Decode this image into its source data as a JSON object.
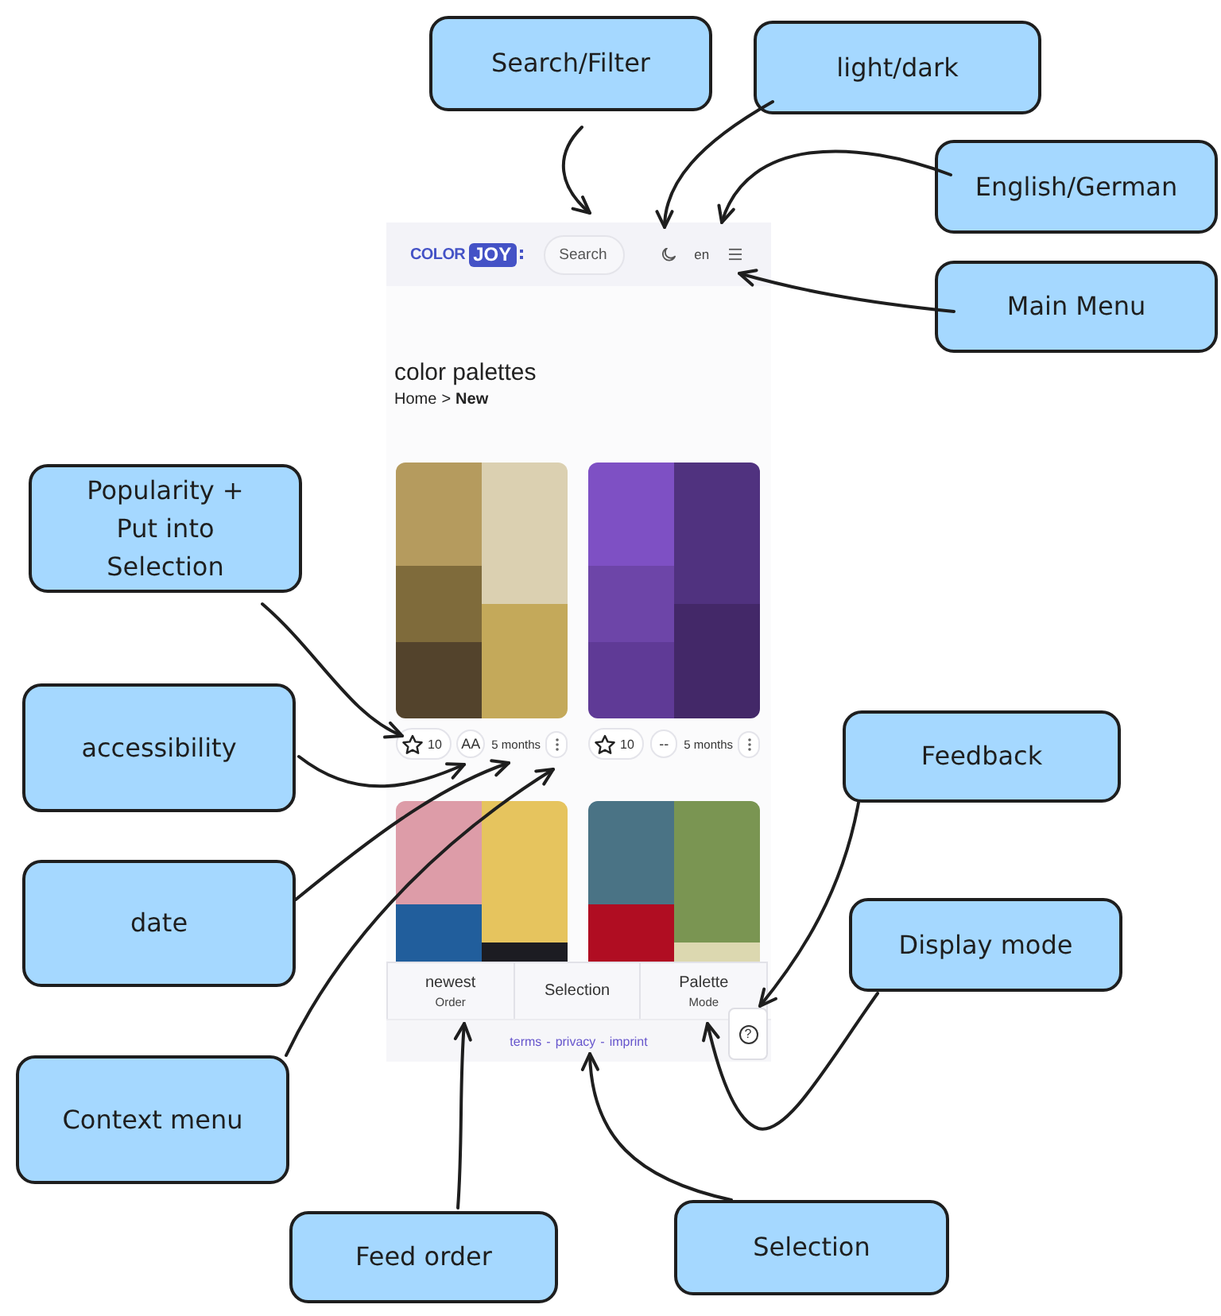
{
  "app": {
    "header": {
      "logo": {
        "text": "COLOR",
        "badge": "JOY"
      },
      "search": {
        "placeholder": "Search"
      },
      "language": "en"
    },
    "title": "color palettes",
    "breadcrumb": {
      "separator": ">",
      "items": [
        {
          "label": "Home",
          "current": false
        },
        {
          "label": "New",
          "current": true
        }
      ]
    },
    "palettes": [
      {
        "swatch_columns": [
          {
            "swatches": [
              {
                "color": "#b59b5e"
              },
              {
                "color": "#7f6b3b"
              },
              {
                "color": "#53432c"
              }
            ]
          },
          {
            "swatches": [
              {
                "color": "#dbd0b1"
              },
              {
                "color": "#c4a95a"
              }
            ]
          }
        ],
        "meta": {
          "starred": false,
          "popularity": "10",
          "accessibility": "AA",
          "age": "5 months"
        }
      },
      {
        "swatch_columns": [
          {
            "swatches": [
              {
                "color": "#7e50c4"
              },
              {
                "color": "#6d45a8"
              },
              {
                "color": "#5f3a96"
              }
            ]
          },
          {
            "swatches": [
              {
                "color": "#50327f"
              },
              {
                "color": "#432868"
              }
            ]
          }
        ],
        "meta": {
          "starred": false,
          "popularity": "10",
          "accessibility": "--",
          "age": "5 months"
        }
      },
      {
        "swatch_columns": [
          {
            "swatches": [
              {
                "color": "#dd9ca8"
              },
              {
                "color": "#215e9c"
              }
            ]
          },
          {
            "swatches": [
              {
                "color": "#e6c45e"
              },
              {
                "color": "#1c1c22"
              }
            ]
          }
        ]
      },
      {
        "swatch_columns": [
          {
            "swatches": [
              {
                "color": "#4a7385"
              },
              {
                "color": "#b00d22"
              }
            ]
          },
          {
            "swatches": [
              {
                "color": "#7a9552"
              },
              {
                "color": "#dcd8b0"
              }
            ]
          }
        ]
      }
    ],
    "toolbar": [
      {
        "value": "newest",
        "label": "Order"
      },
      {
        "value": "Selection"
      },
      {
        "value": "Palette",
        "label": "Mode"
      }
    ],
    "footer": {
      "separator": "-",
      "links": [
        "terms",
        "privacy",
        "imprint"
      ]
    },
    "feedback_button": {
      "label": "?"
    }
  },
  "annotations": [
    {
      "text": "Search/Filter"
    },
    {
      "text": "light/dark"
    },
    {
      "text": "English/German"
    },
    {
      "text": "Main Menu"
    },
    {
      "text": "Popularity + Put into Selection"
    },
    {
      "text": "accessibility"
    },
    {
      "text": "Feedback"
    },
    {
      "text": "date"
    },
    {
      "text": "Display mode"
    },
    {
      "text": "Context menu"
    },
    {
      "text": "Selection"
    },
    {
      "text": "Feed order"
    }
  ]
}
